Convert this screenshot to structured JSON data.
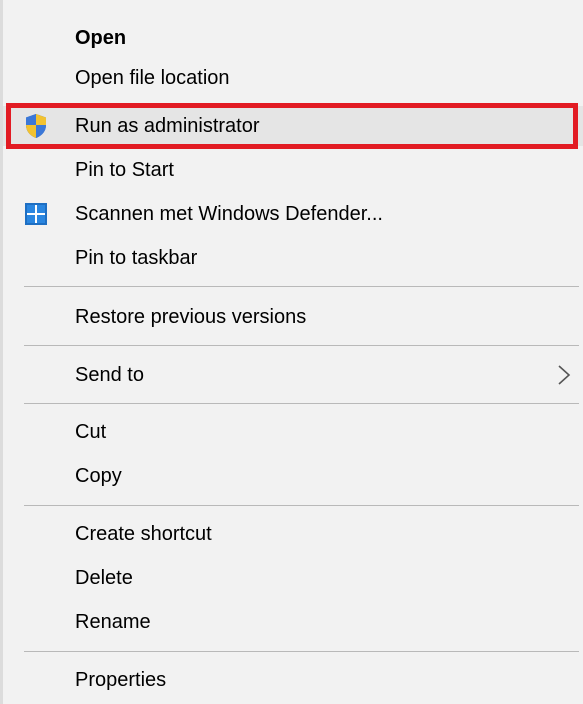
{
  "context_menu": {
    "items": [
      {
        "label": "Open"
      },
      {
        "label": "Open file location"
      },
      {
        "label": "Run as administrator",
        "icon": "uac-shield-icon"
      },
      {
        "label": "Pin to Start"
      },
      {
        "label": "Scannen met Windows Defender...",
        "icon": "windows-defender-icon"
      },
      {
        "label": "Pin to taskbar"
      },
      {
        "label": "Restore previous versions"
      },
      {
        "label": "Send to",
        "submenu": true
      },
      {
        "label": "Cut"
      },
      {
        "label": "Copy"
      },
      {
        "label": "Create shortcut"
      },
      {
        "label": "Delete"
      },
      {
        "label": "Rename"
      },
      {
        "label": "Properties"
      }
    ],
    "highlighted_item": "Run as administrator",
    "colors": {
      "menu_background": "#f2f2f2",
      "hover_background": "#e5e5e5",
      "annotation_frame": "#e21b23",
      "separator": "#b9b9b9",
      "defender_blue": "#1e6fc3"
    }
  }
}
